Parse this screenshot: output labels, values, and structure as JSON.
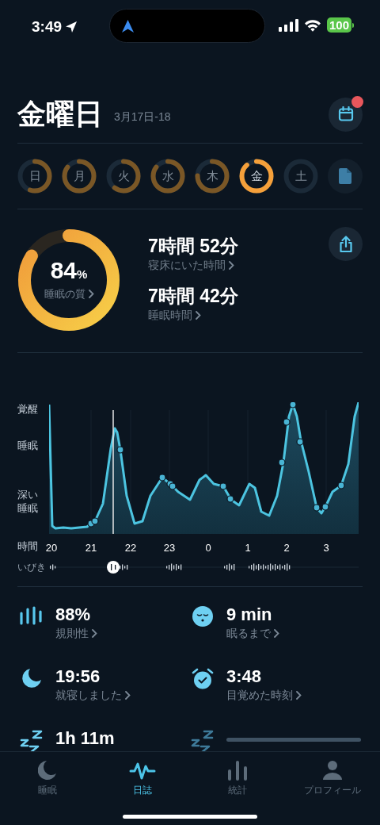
{
  "status_bar": {
    "time": "3:49",
    "battery": "100"
  },
  "header": {
    "title": "金曜日",
    "date_range": "3月17日-18",
    "calendar_badge": true
  },
  "days": [
    {
      "label": "日",
      "selected": false
    },
    {
      "label": "月",
      "selected": false
    },
    {
      "label": "火",
      "selected": false
    },
    {
      "label": "水",
      "selected": false
    },
    {
      "label": "木",
      "selected": false
    },
    {
      "label": "金",
      "selected": true
    },
    {
      "label": "土",
      "selected": false
    }
  ],
  "summary": {
    "quality": {
      "value": "84",
      "unit": "%",
      "label": "睡眠の質",
      "level": 0.84
    },
    "metrics": [
      {
        "value": "7時間 52分",
        "label": "寝床にいた時間"
      },
      {
        "value": "7時間 42分",
        "label": "睡眠時間"
      }
    ]
  },
  "chart": {
    "y_labels": [
      "覚醒",
      "睡眠",
      "深い睡眠"
    ],
    "time_label": "時間",
    "x_labels": [
      "20",
      "21",
      "22",
      "23",
      "0",
      "1",
      "2",
      "3"
    ],
    "snore_label": "いびき"
  },
  "stats": [
    {
      "kind": "regularity",
      "value": "88%",
      "label": "規則性"
    },
    {
      "kind": "fall_asleep",
      "value": "9 min",
      "label": "眠るまで"
    },
    {
      "kind": "bedtime",
      "value": "19:56",
      "label": "就寝しました"
    },
    {
      "kind": "wake",
      "value": "3:48",
      "label": "目覚めた時刻"
    },
    {
      "kind": "snore",
      "value": "1h 11m"
    },
    {
      "kind": "loading"
    }
  ],
  "tabs": [
    {
      "label": "睡眠",
      "selected": false
    },
    {
      "label": "日誌",
      "selected": true
    },
    {
      "label": "統計",
      "selected": false
    },
    {
      "label": "プロフィール",
      "selected": false
    }
  ]
}
